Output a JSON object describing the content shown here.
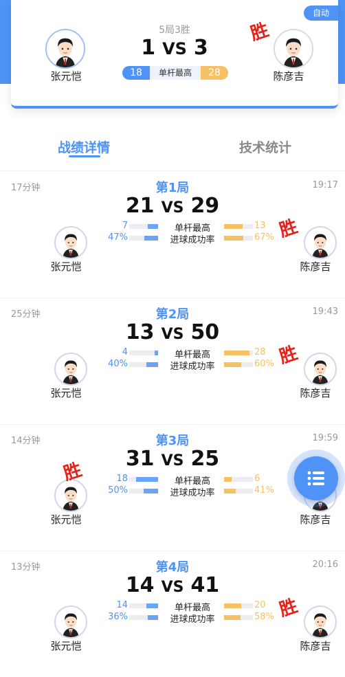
{
  "summary": {
    "auto_badge": "自动",
    "format": "5局3胜",
    "left_score": "1",
    "right_score": "3",
    "vs": "VS",
    "left_player": "张元恺",
    "right_player": "陈彦吉",
    "stat_label": "单杆最高",
    "left_stat": "18",
    "right_stat": "28",
    "win_mark": "胜"
  },
  "tabs": [
    {
      "label": "战绩详情",
      "active": true
    },
    {
      "label": "技术统计",
      "active": false
    }
  ],
  "games": [
    {
      "title": "第1局",
      "duration": "17分钟",
      "time": "19:17",
      "left_score": "21",
      "right_score": "29",
      "vs": "VS",
      "left_player": "张元恺",
      "right_player": "陈彦吉",
      "winner": "right",
      "win_mark": "胜",
      "stats": [
        {
          "label": "单杆最高",
          "left": "7",
          "right": "13",
          "left_level": 0.35,
          "right_level": 0.65
        },
        {
          "label": "进球成功率",
          "left": "47%",
          "right": "67%",
          "left_level": 0.47,
          "right_level": 0.67
        }
      ]
    },
    {
      "title": "第2局",
      "duration": "25分钟",
      "time": "19:43",
      "left_score": "13",
      "right_score": "50",
      "vs": "VS",
      "left_player": "张元恺",
      "right_player": "陈彦吉",
      "winner": "right",
      "win_mark": "胜",
      "stats": [
        {
          "label": "单杆最高",
          "left": "4",
          "right": "28",
          "left_level": 0.125,
          "right_level": 0.875
        },
        {
          "label": "进球成功率",
          "left": "40%",
          "right": "60%",
          "left_level": 0.4,
          "right_level": 0.6
        }
      ]
    },
    {
      "title": "第3局",
      "duration": "14分钟",
      "time": "19:59",
      "left_score": "31",
      "right_score": "25",
      "vs": "VS",
      "left_player": "张元恺",
      "right_player": "陈彦吉",
      "winner": "left",
      "win_mark": "胜",
      "stats": [
        {
          "label": "单杆最高",
          "left": "18",
          "right": "6",
          "left_level": 0.75,
          "right_level": 0.25
        },
        {
          "label": "进球成功率",
          "left": "50%",
          "right": "41%",
          "left_level": 0.5,
          "right_level": 0.41
        }
      ]
    },
    {
      "title": "第4局",
      "duration": "13分钟",
      "time": "20:16",
      "left_score": "14",
      "right_score": "41",
      "vs": "VS",
      "left_player": "张元恺",
      "right_player": "陈彦吉",
      "winner": "right",
      "win_mark": "胜",
      "stats": [
        {
          "label": "单杆最高",
          "left": "14",
          "right": "20",
          "left_level": 0.41,
          "right_level": 0.59
        },
        {
          "label": "进球成功率",
          "left": "36%",
          "right": "58%",
          "left_level": 0.36,
          "right_level": 0.58
        }
      ]
    }
  ],
  "fab": {
    "icon": "list-icon"
  },
  "colors": {
    "accent": "#4e93f5",
    "secondary": "#f6c064",
    "win": "#e0231b"
  }
}
